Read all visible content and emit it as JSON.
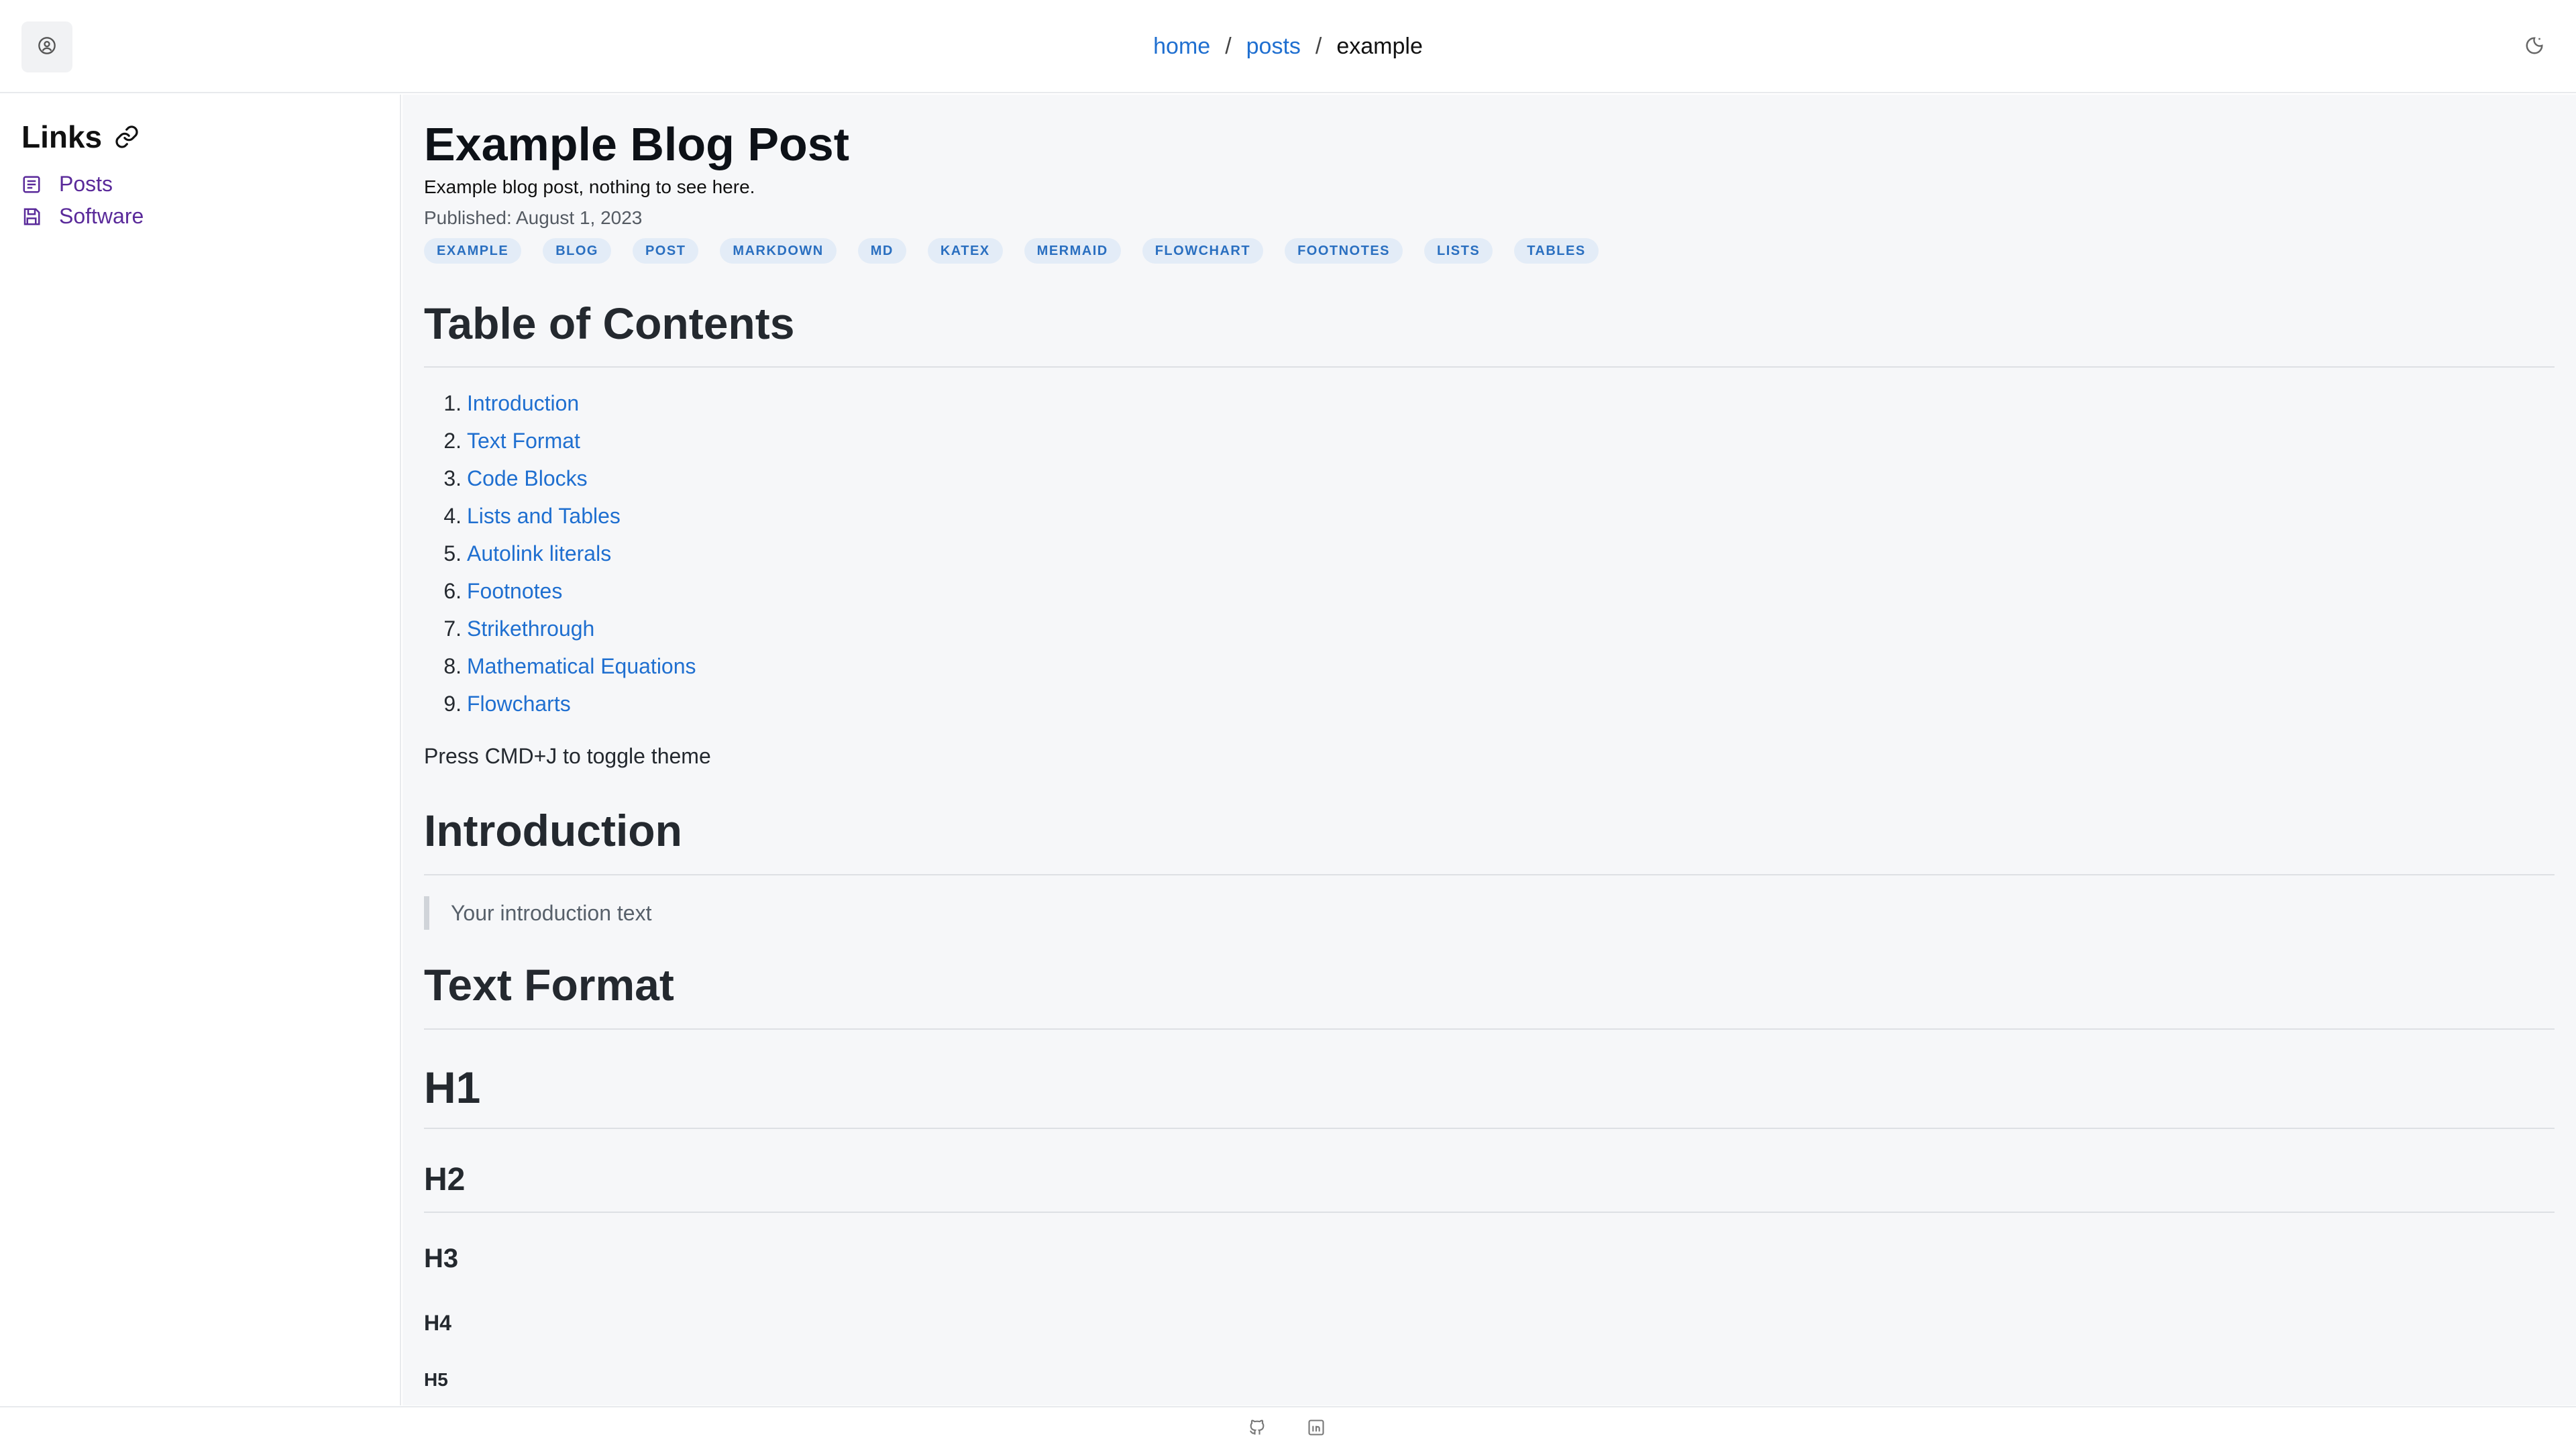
{
  "header": {
    "breadcrumb": {
      "home": "home",
      "posts": "posts",
      "current": "example",
      "separator": "/"
    },
    "user_icon": "user-circle-icon",
    "theme_icon": "moon-icon"
  },
  "sidebar": {
    "title": "Links",
    "title_icon": "link-icon",
    "items": [
      {
        "label": "Posts",
        "icon": "note-icon"
      },
      {
        "label": "Software",
        "icon": "save-icon"
      }
    ]
  },
  "post": {
    "title": "Example Blog Post",
    "description": "Example blog post, nothing to see here.",
    "published": "Published: August 1, 2023",
    "tags": [
      "EXAMPLE",
      "BLOG",
      "POST",
      "MARKDOWN",
      "MD",
      "KATEX",
      "MERMAID",
      "FLOWCHART",
      "FOOTNOTES",
      "LISTS",
      "TABLES"
    ]
  },
  "toc": {
    "heading": "Table of Contents",
    "items": [
      {
        "num": "1.",
        "label": "Introduction"
      },
      {
        "num": "2.",
        "label": "Text Format"
      },
      {
        "num": "3.",
        "label": "Code Blocks"
      },
      {
        "num": "4.",
        "label": "Lists and Tables"
      },
      {
        "num": "5.",
        "label": "Autolink literals"
      },
      {
        "num": "6.",
        "label": "Footnotes"
      },
      {
        "num": "7.",
        "label": "Strikethrough"
      },
      {
        "num": "8.",
        "label": "Mathematical Equations"
      },
      {
        "num": "9.",
        "label": "Flowcharts"
      }
    ]
  },
  "theme_hint": "Press CMD+J to toggle theme",
  "sections": {
    "introduction": {
      "heading": "Introduction",
      "quote": "Your introduction text"
    },
    "text_format": {
      "heading": "Text Format",
      "h1": "H1",
      "h2": "H2",
      "h3": "H3",
      "h4": "H4",
      "h5": "H5"
    }
  },
  "footer": {
    "icons": [
      "github-icon",
      "linkedin-icon"
    ]
  },
  "colors": {
    "link": "#1f6fd0",
    "sidebar_link": "#5a2a9a",
    "tag_bg": "#e3ecf7",
    "tag_text": "#2a6fc0",
    "main_bg": "#f6f7f9"
  }
}
